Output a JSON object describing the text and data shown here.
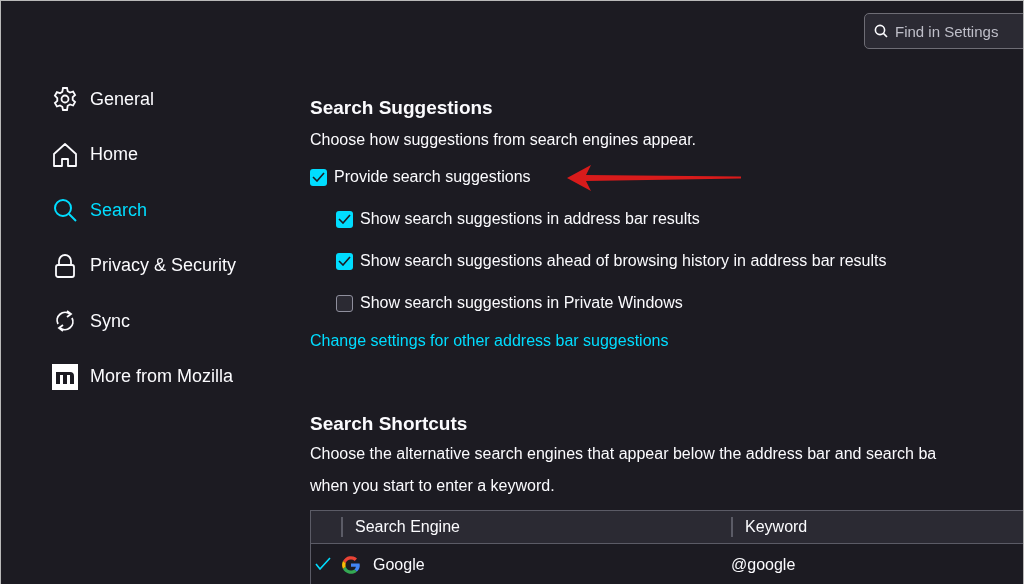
{
  "search_field": {
    "placeholder": "Find in Settings"
  },
  "sidebar": {
    "items": [
      {
        "label": "General",
        "selected": false
      },
      {
        "label": "Home",
        "selected": false
      },
      {
        "label": "Search",
        "selected": true
      },
      {
        "label": "Privacy & Security",
        "selected": false
      },
      {
        "label": "Sync",
        "selected": false
      },
      {
        "label": "More from Mozilla",
        "selected": false
      }
    ]
  },
  "search_suggestions": {
    "title": "Search Suggestions",
    "description": "Choose how suggestions from search engines appear.",
    "options": [
      {
        "label": "Provide search suggestions",
        "checked": true,
        "children": [
          {
            "label": "Show search suggestions in address bar results",
            "checked": true
          },
          {
            "label": "Show search suggestions ahead of browsing history in address bar results",
            "checked": true
          },
          {
            "label": "Show search suggestions in Private Windows",
            "checked": false
          }
        ]
      }
    ],
    "link": "Change settings for other address bar suggestions"
  },
  "annotation": {
    "kind": "arrow"
  },
  "search_shortcuts": {
    "title": "Search Shortcuts",
    "description_lines": [
      "Choose the alternative search engines that appear below the address bar and search ba",
      "when you start to enter a keyword."
    ],
    "table": {
      "columns": [
        "Search Engine",
        "Keyword"
      ],
      "rows": [
        {
          "name": "Google",
          "keyword": "@google",
          "checked": true
        }
      ]
    }
  }
}
